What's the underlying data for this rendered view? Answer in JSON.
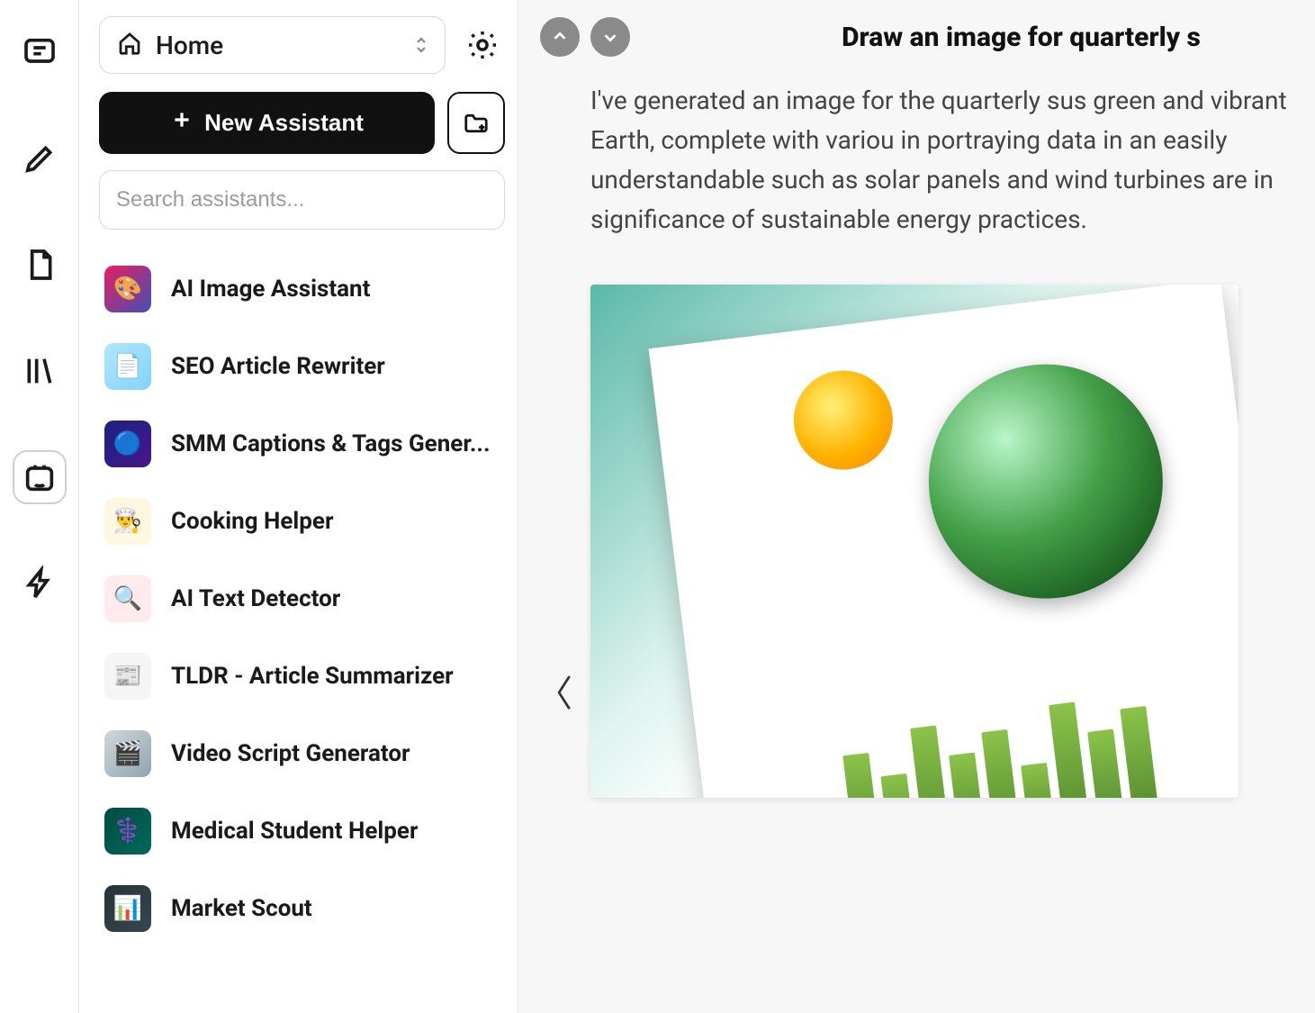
{
  "sidebar": {
    "home_label": "Home",
    "new_assistant_label": "New Assistant",
    "search_placeholder": "Search assistants...",
    "assistants": [
      {
        "label": "AI Image Assistant",
        "icon": "🎨"
      },
      {
        "label": "SEO Article Rewriter",
        "icon": "📄"
      },
      {
        "label": "SMM Captions & Tags Gener...",
        "icon": "🔵"
      },
      {
        "label": "Cooking Helper",
        "icon": "👨‍🍳"
      },
      {
        "label": "AI Text Detector",
        "icon": "🔍"
      },
      {
        "label": "TLDR - Article Summarizer",
        "icon": "📰"
      },
      {
        "label": "Video Script Generator",
        "icon": "🎬"
      },
      {
        "label": "Medical Student Helper",
        "icon": "⚕️"
      },
      {
        "label": "Market Scout",
        "icon": "📊"
      }
    ]
  },
  "main": {
    "title": "Draw an image for quarterly s",
    "response_text": "I've generated an image for the quarterly sus green and vibrant Earth, complete with variou in portraying data in an easily understandable such as solar panels and wind turbines are in significance of sustainable energy practices."
  }
}
